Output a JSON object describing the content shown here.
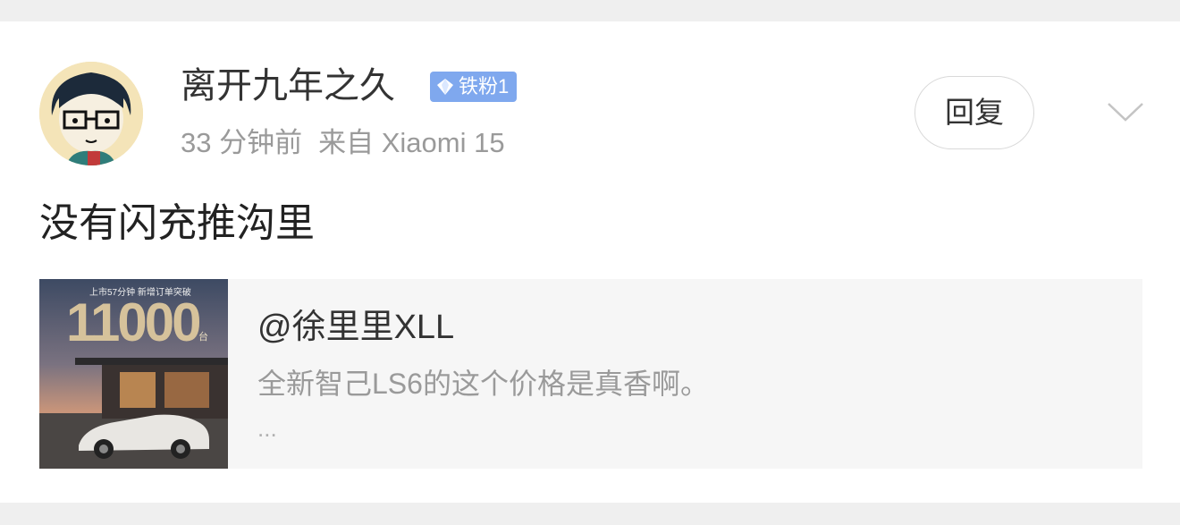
{
  "post": {
    "username": "离开九年之久",
    "badge": "铁粉1",
    "time": "33 分钟前",
    "source": "来自 Xiaomi 15",
    "reply_label": "回复",
    "content": "没有闪充推沟里",
    "more_icon": "chevron-down-icon"
  },
  "share": {
    "title": "@徐里里XLL",
    "desc": "全新智己LS6的这个价格是真香啊。",
    "more": "...",
    "thumb_caption": "上市57分钟 新增订单突破",
    "thumb_number": "11000",
    "thumb_unit": "台"
  },
  "colors": {
    "badge": "#7fa8ee",
    "meta_text": "#9a9a9a",
    "card_bg": "#ffffff",
    "page_bg": "#efefef",
    "share_bg": "#f6f6f6"
  }
}
